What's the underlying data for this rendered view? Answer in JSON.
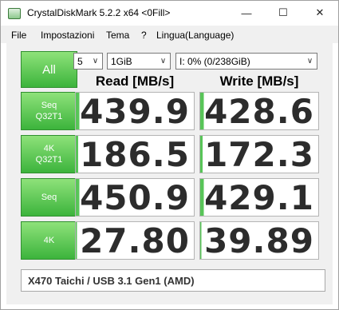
{
  "window": {
    "title": "CrystalDiskMark 5.2.2 x64 <0Fill>",
    "controls": {
      "minimize": "—",
      "maximize": "☐",
      "close": "✕"
    }
  },
  "menu": [
    "File",
    "Impostazioni",
    "Tema",
    "?",
    "Lingua(Language)"
  ],
  "toolbar": {
    "all_label": "All",
    "count": "5",
    "size": "1GiB",
    "drive": "I: 0% (0/238GiB)"
  },
  "headers": {
    "read": "Read [MB/s]",
    "write": "Write [MB/s]"
  },
  "tests": [
    {
      "label_line1": "Seq",
      "label_line2": "Q32T1",
      "read": "439.9",
      "write": "428.6",
      "read_fill": 0.03,
      "write_fill": 0.03
    },
    {
      "label_line1": "4K",
      "label_line2": "Q32T1",
      "read": "186.5",
      "write": "172.3",
      "read_fill": 0.02,
      "write_fill": 0.02
    },
    {
      "label_line1": "Seq",
      "label_line2": "",
      "read": "450.9",
      "write": "429.1",
      "read_fill": 0.03,
      "write_fill": 0.03
    },
    {
      "label_line1": "4K",
      "label_line2": "",
      "read": "27.80",
      "write": "39.89",
      "read_fill": 0.01,
      "write_fill": 0.01
    }
  ],
  "comment": "X470 Taichi / USB 3.1 Gen1 (AMD)",
  "colors": {
    "accent_green": "#3cb43c",
    "bar_green": "#58c558"
  }
}
